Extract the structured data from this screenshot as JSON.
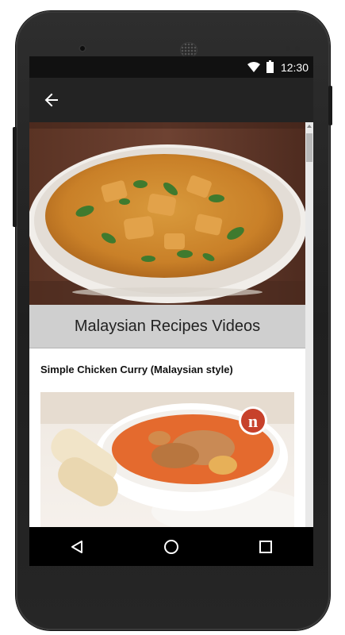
{
  "status_bar": {
    "time": "12:30",
    "icons": [
      "wifi-icon",
      "battery-icon"
    ]
  },
  "app_bar": {
    "back_icon": "arrow-left-icon"
  },
  "content": {
    "hero_image": "curry-bowl-photo",
    "section_title": "Malaysian Recipes Videos",
    "recipe": {
      "title": "Simple Chicken Curry (Malaysian style)",
      "image": "chicken-curry-photo",
      "badge_letter": "n"
    }
  },
  "nav_bar": {
    "items": [
      "back-triangle-icon",
      "home-circle-icon",
      "recents-square-icon"
    ]
  },
  "colors": {
    "status_bar": "#111111",
    "app_bar": "#232323",
    "title_band": "#cfcfcf",
    "nav_bar": "#000000",
    "badge": "#c7412b"
  }
}
